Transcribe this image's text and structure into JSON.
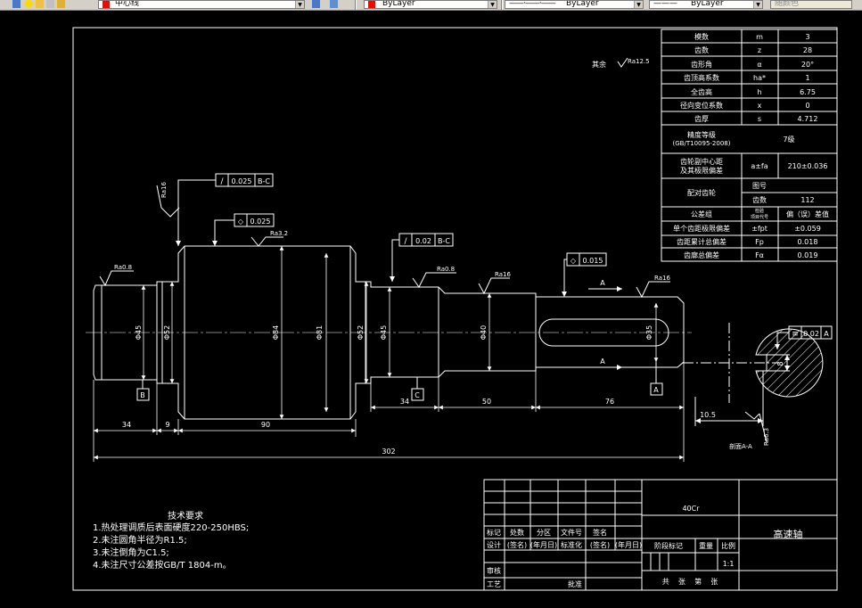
{
  "toolbar": {
    "layer_name": "中心线",
    "color": "ByLayer",
    "linetype": "ByLayer",
    "lineweight": "ByLayer",
    "plotstyle": "随颜色",
    "accent_red": "#ff0000"
  },
  "drawing": {
    "roughness_general": "其余",
    "roughness_general_value": "Ra12.5",
    "roughness": {
      "r1": "Ra16",
      "r2": "Ra3.2",
      "r3": "Ra0.8",
      "r4": "Ra0.8",
      "r5": "Ra16",
      "r6": "Ra16",
      "r7": "Ra6.3"
    },
    "gdt": {
      "f1_sym": "/",
      "f1_val": "0.025",
      "f1_ref": "B-C",
      "f2_sym": "◇",
      "f2_val": "0.025",
      "f3_sym": "/",
      "f3_val": "0.02",
      "f3_ref": "B-C",
      "f4_sym": "◇",
      "f4_val": "0.015",
      "f5_sym": "≡",
      "f5_val": "0.02",
      "f5_ref": "A"
    },
    "diameters": {
      "d1": "Φ45",
      "d2": "Φ52",
      "d3": "Φ84",
      "d4": "Φ81",
      "d5": "Φ52",
      "d6": "Φ45",
      "d7": "Φ40",
      "d8": "Φ35"
    },
    "datums": {
      "b": "B",
      "c": "C",
      "a": "A",
      "a_arrow1": "A",
      "a_arrow2": "A"
    },
    "dims": {
      "l34a": "34",
      "l9": "9",
      "l90": "90",
      "l34b": "34",
      "l50": "50",
      "l76": "76",
      "l302": "302",
      "l10_5": "10.5",
      "l8": "8"
    },
    "section_label": "剖面A-A"
  },
  "gear_table": [
    [
      "模数",
      "m",
      "3"
    ],
    [
      "齿数",
      "z",
      "28"
    ],
    [
      "齿形角",
      "α",
      "20°"
    ],
    [
      "齿顶高系数",
      "ha*",
      "1"
    ],
    [
      "全齿高",
      "h",
      "6.75"
    ],
    [
      "径向变位系数",
      "x",
      "0"
    ],
    [
      "齿厚",
      "s",
      "4.712"
    ]
  ],
  "gear_table2": {
    "accuracy_label": "精度等级",
    "accuracy_std": "(GB/T10095-2008)",
    "accuracy_val": "7级",
    "center_label1": "齿轮副中心距",
    "center_label2": "及其极限偏差",
    "center_sym": "a±fa",
    "center_val": "210±0.036",
    "mate_label": "配对齿轮",
    "mate_draw": "图号",
    "mate_teeth": "齿数",
    "mate_teeth_val": "112",
    "tol_label": "公差组",
    "tol_sym_top": "检验",
    "tol_sym": "项目代号",
    "tol_val": "偏（误）差值",
    "r1": [
      "单个齿距极限偏差",
      "±fpt",
      "±0.059"
    ],
    "r2": [
      "齿距累计总偏差",
      "Fp",
      "0.018"
    ],
    "r3": [
      "齿廓总偏差",
      "Fα",
      "0.019"
    ]
  },
  "notes": {
    "title": "技术要求",
    "lines": [
      "1.热处理调质后表面硬度220-250HBS;",
      "2.未注圆角半径为R1.5;",
      "3.未注倒角为C1.5;",
      "4.未注尺寸公差按GB/T 1804-m。"
    ]
  },
  "titleblock": {
    "material": "40Cr",
    "part_name": "高速轴",
    "mark": "标记",
    "count": "处数",
    "zone": "分区",
    "docno": "文件号",
    "sign": "签名",
    "design": "设计",
    "sign_name": "(签名)",
    "date": "(年月日)",
    "standardize": "标准化",
    "sign_name2": "(签名)",
    "date2": "(年月日)",
    "stage": "阶段标记",
    "weight": "重量",
    "scale_label": "比例",
    "scale_val": "1:1",
    "review": "审核",
    "process": "工艺",
    "approve": "批准",
    "sheets": "共    张    第    张"
  }
}
